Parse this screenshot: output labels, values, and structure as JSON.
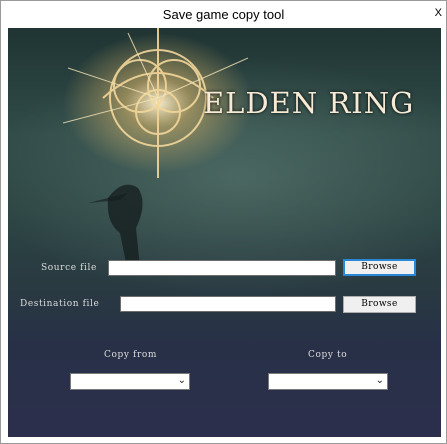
{
  "window": {
    "title": "Save game copy tool",
    "close_label": "X"
  },
  "logo": {
    "text": "ELDEN RING",
    "color": "#f5ead6"
  },
  "form": {
    "source_label": "Source file",
    "destination_label": "Destination file",
    "source_value": "",
    "destination_value": "",
    "browse_label": "Browse",
    "copy_from_label": "Copy from",
    "copy_to_label": "Copy to",
    "copy_from_value": "",
    "copy_to_value": ""
  },
  "colors": {
    "focus_border": "#2a86d6",
    "label_text": "#dcdcdc"
  }
}
